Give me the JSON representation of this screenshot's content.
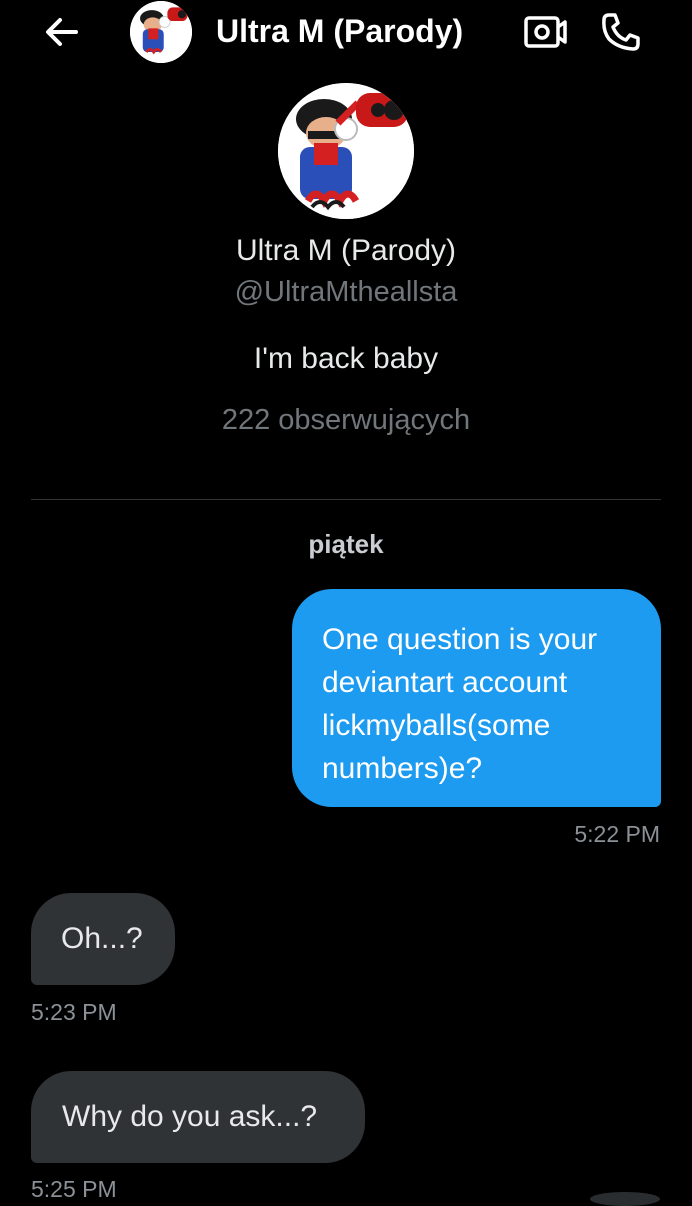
{
  "header": {
    "title": "Ultra M (Parody)",
    "back_icon": "arrow-left-icon",
    "video_icon": "video-call-icon",
    "call_icon": "phone-icon"
  },
  "profile": {
    "name": "Ultra M (Parody)",
    "handle": "@UltraMtheallsta",
    "bio": "I'm back baby",
    "followers": "222 obserwujących"
  },
  "conversation": {
    "day_label": "piątek",
    "messages": [
      {
        "direction": "outgoing",
        "text": "One question is your deviantart account lickmyballs(some numbers)e?",
        "time": "5:22 PM"
      },
      {
        "direction": "incoming",
        "text": "Oh...?",
        "time": "5:23 PM"
      },
      {
        "direction": "incoming",
        "text": "Why do you ask...?",
        "time": "5:25 PM"
      }
    ]
  },
  "colors": {
    "background": "#000000",
    "outgoing_bubble": "#1d9bf0",
    "incoming_bubble": "#2f3336",
    "secondary_text": "#71767b"
  }
}
